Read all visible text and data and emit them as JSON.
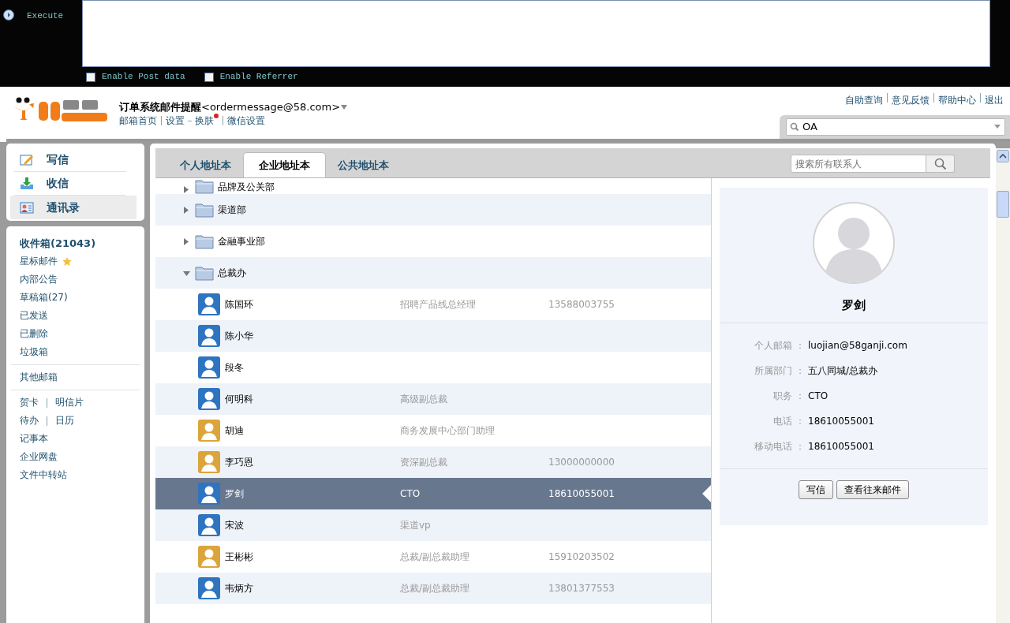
{
  "tool_bar": {
    "action": "Execute",
    "post_data": {
      "label": "Enable Post data",
      "checked": false
    },
    "referrer": {
      "label": "Enable Referrer",
      "checked": false
    }
  },
  "header": {
    "sender_name": "订单系统邮件提醒",
    "sender_address": "<ordermessage@58.com>",
    "links": [
      "邮箱首页",
      "设置",
      "换肤",
      "微信设置"
    ],
    "top_links": [
      "自助查询",
      "意见反馈",
      "帮助中心",
      "退出"
    ],
    "search": {
      "value": "OA"
    }
  },
  "nav": [
    {
      "label": "写信",
      "kind": "compose",
      "selected": false
    },
    {
      "label": "收信",
      "kind": "inbox",
      "selected": false
    },
    {
      "label": "通讯录",
      "kind": "contacts",
      "selected": true
    }
  ],
  "folders": [
    [
      {
        "label": "收件箱(21043)",
        "bold": true
      },
      {
        "label": "星标邮件",
        "starred": true
      },
      {
        "label": "内部公告"
      },
      {
        "label": "草稿箱(27)"
      },
      {
        "label": "已发送"
      },
      {
        "label": "已删除"
      },
      {
        "label": "垃圾箱"
      }
    ],
    [
      {
        "label": "其他邮箱"
      }
    ],
    [
      {
        "label": "贺卡",
        "pair": "明信片"
      },
      {
        "label": "待办",
        "pair": "日历"
      },
      {
        "label": "记事本"
      },
      {
        "label": "企业网盘"
      },
      {
        "label": "文件中转站"
      }
    ]
  ],
  "tabs": [
    {
      "label": "个人地址本",
      "selected": false
    },
    {
      "label": "企业地址本",
      "selected": true
    },
    {
      "label": "公共地址本",
      "selected": false
    }
  ],
  "contact_search": {
    "placeholder": "搜索所有联系人"
  },
  "departments": [
    {
      "name": "品牌及公关部",
      "expanded": false
    },
    {
      "name": "渠道部",
      "expanded": false
    },
    {
      "name": "金融事业部",
      "expanded": false
    },
    {
      "name": "总裁办",
      "expanded": true,
      "contacts": [
        {
          "name": "陈国环",
          "title": "招聘产品线总经理",
          "phone": "13588003755",
          "color": "#2f74c0",
          "selected": false
        },
        {
          "name": "陈小华",
          "color": "#2f74c0",
          "selected": false
        },
        {
          "name": "段冬",
          "color": "#2f74c0",
          "selected": false
        },
        {
          "name": "何明科",
          "title": "高级副总裁",
          "color": "#2f74c0",
          "selected": false
        },
        {
          "name": "胡迪",
          "title": "商务发展中心部门助理",
          "color": "#dca53c",
          "selected": false
        },
        {
          "name": "李巧恩",
          "title": "资深副总裁",
          "phone": "13000000000",
          "color": "#dca53c",
          "selected": false
        },
        {
          "name": "罗剑",
          "title": "CTO",
          "phone": "18610055001",
          "color": "#2f74c0",
          "selected": true
        },
        {
          "name": "宋波",
          "title": "渠道vp",
          "color": "#2f74c0",
          "selected": false
        },
        {
          "name": "王彬彬",
          "title": "总裁/副总裁助理",
          "phone": "15910203502",
          "color": "#dca53c",
          "selected": false
        },
        {
          "name": "韦炳方",
          "title": "总裁/副总裁助理",
          "phone": "13801377553",
          "color": "#2f74c0",
          "selected": false
        }
      ]
    }
  ],
  "detail": {
    "name": "罗剑",
    "fields": [
      {
        "label": "个人邮箱 ：",
        "value": "luojian@58ganji.com"
      },
      {
        "label": "所属部门 ：",
        "value": "五八同城/总裁办"
      },
      {
        "label": "职务 ：",
        "value": "CTO"
      },
      {
        "label": "电话 ：",
        "value": "18610055001"
      },
      {
        "label": "移动电话 ：",
        "value": "18610055001"
      }
    ],
    "buttons": [
      "写信",
      "查看往来邮件"
    ]
  }
}
